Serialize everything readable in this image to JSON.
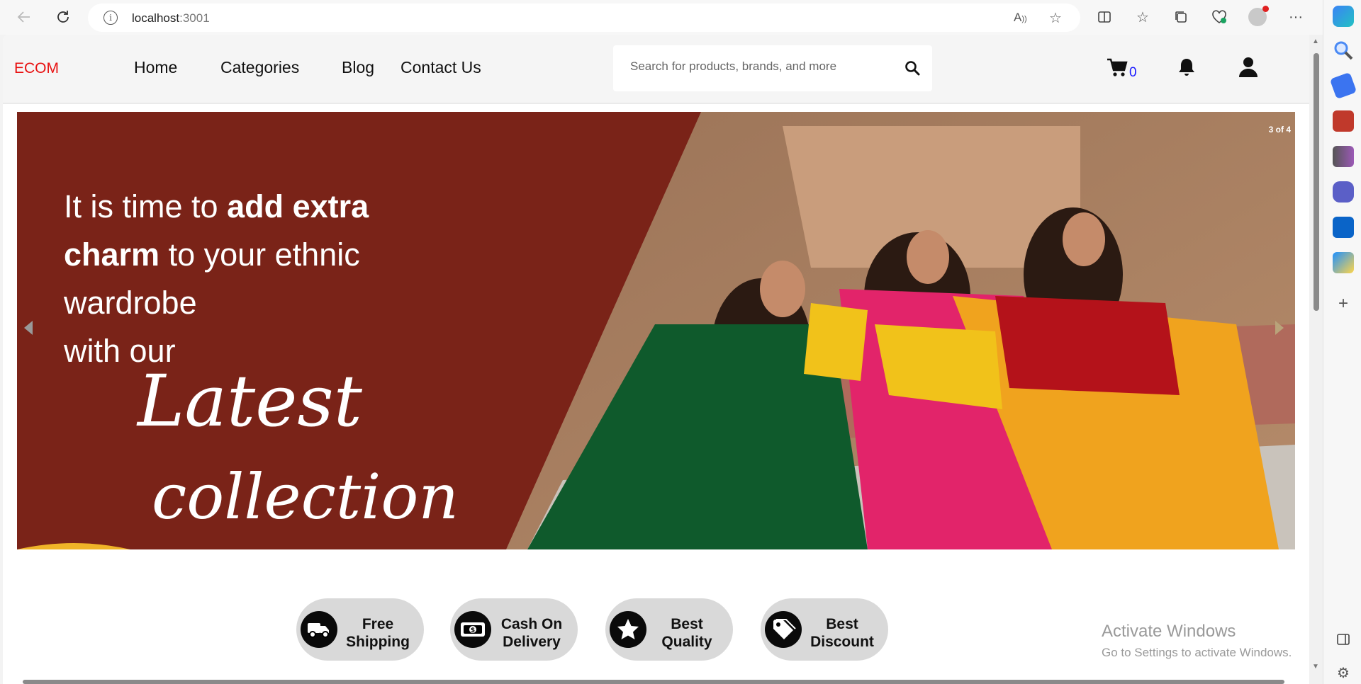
{
  "browser": {
    "url_host": "localhost",
    "url_port": ":3001"
  },
  "site": {
    "logo": "ECOM",
    "nav": {
      "home": "Home",
      "categories": "Categories",
      "blog": "Blog",
      "contact": "Contact Us"
    },
    "search_placeholder": "Search for products, brands, and more",
    "cart_count": "0",
    "colors": {
      "logo": "#e81010",
      "cart_count": "#1a1aff",
      "banner_bg": "#7a2318"
    }
  },
  "carousel": {
    "counter": "3 of 4",
    "line1_light": "It is time to ",
    "line1_bold": "add extra",
    "line2_bold": "charm",
    "line2_light": " to your ethnic",
    "line3": "wardrobe",
    "line4": "with our",
    "script1": "Latest",
    "script2": "collection"
  },
  "features": [
    {
      "label_1": "Free",
      "label_2": "Shipping",
      "icon": "truck-icon"
    },
    {
      "label_1": "Cash On",
      "label_2": "Delivery",
      "icon": "cash-icon"
    },
    {
      "label_1": "Best",
      "label_2": "Quality",
      "icon": "star-icon"
    },
    {
      "label_1": "Best",
      "label_2": "Discount",
      "icon": "tag-icon"
    }
  ],
  "watermark": {
    "title": "Activate Windows",
    "subtitle": "Go to Settings to activate Windows."
  }
}
